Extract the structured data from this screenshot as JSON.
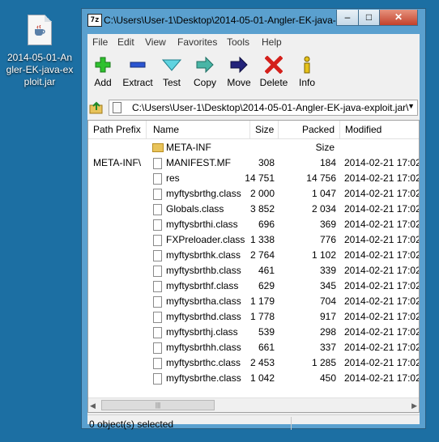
{
  "desktop": {
    "file_label": "2014-05-01-Angler-EK-java-exploit.jar"
  },
  "window": {
    "title": "C:\\Users\\User-1\\Desktop\\2014-05-01-Angler-EK-java-",
    "app_icon": "7z",
    "buttons": {
      "minimize": "–",
      "maximize": "□",
      "close": "✕"
    }
  },
  "menu": [
    "File",
    "Edit",
    "View",
    "Favorites",
    "Tools",
    "Help"
  ],
  "toolbar": {
    "add": "Add",
    "extract": "Extract",
    "test": "Test",
    "copy": "Copy",
    "move": "Move",
    "delete": "Delete",
    "info": "Info"
  },
  "address": {
    "path": "C:\\Users\\User-1\\Desktop\\2014-05-01-Angler-EK-java-exploit.jar\\"
  },
  "columns": {
    "prefix": "Path Prefix",
    "name": "Name",
    "size": "Size",
    "packed": "Packed Size",
    "modified": "Modified"
  },
  "rows": [
    {
      "prefix": "",
      "name": "META-INF",
      "size": "",
      "packed": "",
      "modified": "",
      "folder": true
    },
    {
      "prefix": "META-INF\\",
      "name": "MANIFEST.MF",
      "size": "308",
      "packed": "184",
      "modified": "2014-02-21 17:02"
    },
    {
      "prefix": "",
      "name": "res",
      "size": "14 751",
      "packed": "14 756",
      "modified": "2014-02-21 17:02"
    },
    {
      "prefix": "",
      "name": "myftysbrthg.class",
      "size": "2 000",
      "packed": "1 047",
      "modified": "2014-02-21 17:02"
    },
    {
      "prefix": "",
      "name": "Globals.class",
      "size": "3 852",
      "packed": "2 034",
      "modified": "2014-02-21 17:02"
    },
    {
      "prefix": "",
      "name": "myftysbrthi.class",
      "size": "696",
      "packed": "369",
      "modified": "2014-02-21 17:02"
    },
    {
      "prefix": "",
      "name": "FXPreloader.class",
      "size": "1 338",
      "packed": "776",
      "modified": "2014-02-21 17:02"
    },
    {
      "prefix": "",
      "name": "myftysbrthk.class",
      "size": "2 764",
      "packed": "1 102",
      "modified": "2014-02-21 17:02"
    },
    {
      "prefix": "",
      "name": "myftysbrthb.class",
      "size": "461",
      "packed": "339",
      "modified": "2014-02-21 17:02"
    },
    {
      "prefix": "",
      "name": "myftysbrthf.class",
      "size": "629",
      "packed": "345",
      "modified": "2014-02-21 17:02"
    },
    {
      "prefix": "",
      "name": "myftysbrtha.class",
      "size": "1 179",
      "packed": "704",
      "modified": "2014-02-21 17:02"
    },
    {
      "prefix": "",
      "name": "myftysbrthd.class",
      "size": "1 778",
      "packed": "917",
      "modified": "2014-02-21 17:02"
    },
    {
      "prefix": "",
      "name": "myftysbrthj.class",
      "size": "539",
      "packed": "298",
      "modified": "2014-02-21 17:02"
    },
    {
      "prefix": "",
      "name": "myftysbrthh.class",
      "size": "661",
      "packed": "337",
      "modified": "2014-02-21 17:02"
    },
    {
      "prefix": "",
      "name": "myftysbrthc.class",
      "size": "2 453",
      "packed": "1 285",
      "modified": "2014-02-21 17:02"
    },
    {
      "prefix": "",
      "name": "myftysbrthe.class",
      "size": "1 042",
      "packed": "450",
      "modified": "2014-02-21 17:02"
    }
  ],
  "status": {
    "text": "0 object(s) selected"
  }
}
